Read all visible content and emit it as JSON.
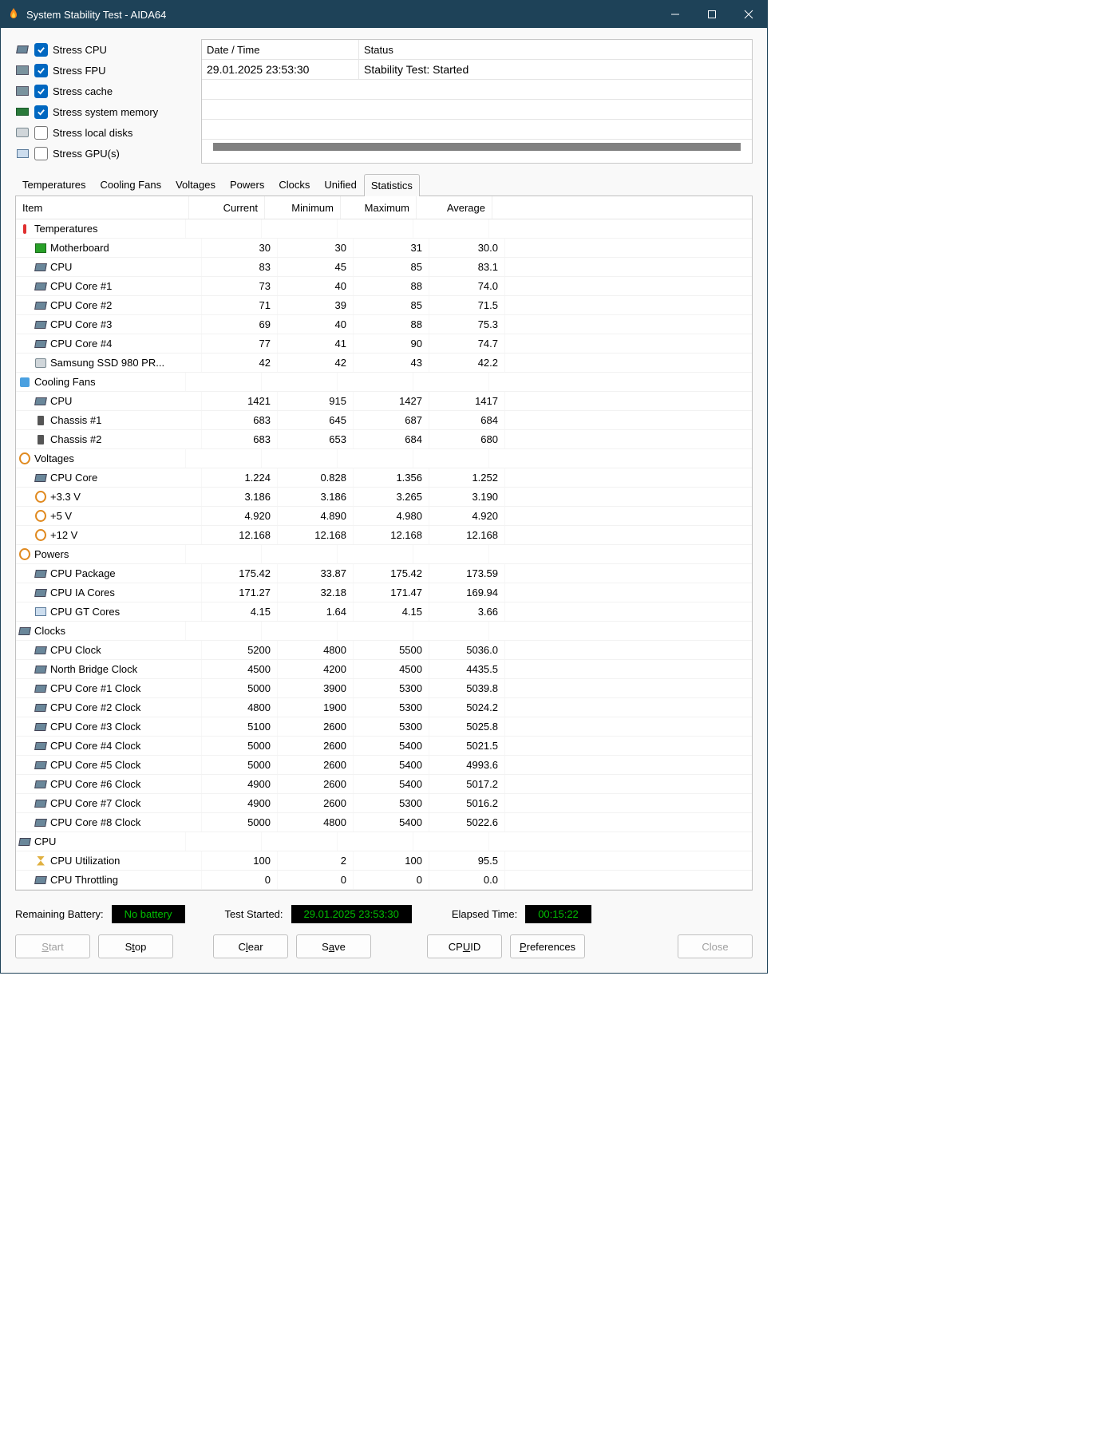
{
  "title": "System Stability Test - AIDA64",
  "stress": [
    {
      "label": "Stress CPU",
      "checked": true,
      "icon": "cpu"
    },
    {
      "label": "Stress FPU",
      "checked": true,
      "icon": "fpu"
    },
    {
      "label": "Stress cache",
      "checked": true,
      "icon": "cache"
    },
    {
      "label": "Stress system memory",
      "checked": true,
      "icon": "mem"
    },
    {
      "label": "Stress local disks",
      "checked": false,
      "icon": "disk"
    },
    {
      "label": "Stress GPU(s)",
      "checked": false,
      "icon": "gpu"
    }
  ],
  "log": {
    "headers": [
      "Date / Time",
      "Status"
    ],
    "rows": [
      [
        "29.01.2025 23:53:30",
        "Stability Test: Started"
      ]
    ]
  },
  "tabs": [
    "Temperatures",
    "Cooling Fans",
    "Voltages",
    "Powers",
    "Clocks",
    "Unified",
    "Statistics"
  ],
  "active_tab": "Statistics",
  "grid_headers": [
    "Item",
    "Current",
    "Minimum",
    "Maximum",
    "Average"
  ],
  "sections": [
    {
      "title": "Temperatures",
      "icon": "therm",
      "rows": [
        {
          "icon": "mb",
          "label": "Motherboard",
          "v": [
            "30",
            "30",
            "31",
            "30.0"
          ]
        },
        {
          "icon": "cpu",
          "label": "CPU",
          "v": [
            "83",
            "45",
            "85",
            "83.1"
          ]
        },
        {
          "icon": "cpu",
          "label": "CPU Core #1",
          "v": [
            "73",
            "40",
            "88",
            "74.0"
          ]
        },
        {
          "icon": "cpu",
          "label": "CPU Core #2",
          "v": [
            "71",
            "39",
            "85",
            "71.5"
          ]
        },
        {
          "icon": "cpu",
          "label": "CPU Core #3",
          "v": [
            "69",
            "40",
            "88",
            "75.3"
          ]
        },
        {
          "icon": "cpu",
          "label": "CPU Core #4",
          "v": [
            "77",
            "41",
            "90",
            "74.7"
          ]
        },
        {
          "icon": "disk",
          "label": "Samsung SSD 980 PR...",
          "v": [
            "42",
            "42",
            "43",
            "42.2"
          ]
        }
      ]
    },
    {
      "title": "Cooling Fans",
      "icon": "fan",
      "rows": [
        {
          "icon": "cpu",
          "label": "CPU",
          "v": [
            "1421",
            "915",
            "1427",
            "1417"
          ]
        },
        {
          "icon": "hd",
          "label": "Chassis #1",
          "v": [
            "683",
            "645",
            "687",
            "684"
          ]
        },
        {
          "icon": "hd",
          "label": "Chassis #2",
          "v": [
            "683",
            "653",
            "684",
            "680"
          ]
        }
      ]
    },
    {
      "title": "Voltages",
      "icon": "volt",
      "rows": [
        {
          "icon": "cpu",
          "label": "CPU Core",
          "v": [
            "1.224",
            "0.828",
            "1.356",
            "1.252"
          ]
        },
        {
          "icon": "volt",
          "label": "+3.3 V",
          "v": [
            "3.186",
            "3.186",
            "3.265",
            "3.190"
          ]
        },
        {
          "icon": "volt",
          "label": "+5 V",
          "v": [
            "4.920",
            "4.890",
            "4.980",
            "4.920"
          ]
        },
        {
          "icon": "volt",
          "label": "+12 V",
          "v": [
            "12.168",
            "12.168",
            "12.168",
            "12.168"
          ]
        }
      ]
    },
    {
      "title": "Powers",
      "icon": "volt",
      "rows": [
        {
          "icon": "cpu",
          "label": "CPU Package",
          "v": [
            "175.42",
            "33.87",
            "175.42",
            "173.59"
          ]
        },
        {
          "icon": "cpu",
          "label": "CPU IA Cores",
          "v": [
            "171.27",
            "32.18",
            "171.47",
            "169.94"
          ]
        },
        {
          "icon": "gpu",
          "label": "CPU GT Cores",
          "v": [
            "4.15",
            "1.64",
            "4.15",
            "3.66"
          ]
        }
      ]
    },
    {
      "title": "Clocks",
      "icon": "cpu",
      "rows": [
        {
          "icon": "cpu",
          "label": "CPU Clock",
          "v": [
            "5200",
            "4800",
            "5500",
            "5036.0"
          ]
        },
        {
          "icon": "cpu",
          "label": "North Bridge Clock",
          "v": [
            "4500",
            "4200",
            "4500",
            "4435.5"
          ]
        },
        {
          "icon": "cpu",
          "label": "CPU Core #1 Clock",
          "v": [
            "5000",
            "3900",
            "5300",
            "5039.8"
          ]
        },
        {
          "icon": "cpu",
          "label": "CPU Core #2 Clock",
          "v": [
            "4800",
            "1900",
            "5300",
            "5024.2"
          ]
        },
        {
          "icon": "cpu",
          "label": "CPU Core #3 Clock",
          "v": [
            "5100",
            "2600",
            "5300",
            "5025.8"
          ]
        },
        {
          "icon": "cpu",
          "label": "CPU Core #4 Clock",
          "v": [
            "5000",
            "2600",
            "5400",
            "5021.5"
          ]
        },
        {
          "icon": "cpu",
          "label": "CPU Core #5 Clock",
          "v": [
            "5000",
            "2600",
            "5400",
            "4993.6"
          ]
        },
        {
          "icon": "cpu",
          "label": "CPU Core #6 Clock",
          "v": [
            "4900",
            "2600",
            "5400",
            "5017.2"
          ]
        },
        {
          "icon": "cpu",
          "label": "CPU Core #7 Clock",
          "v": [
            "4900",
            "2600",
            "5300",
            "5016.2"
          ]
        },
        {
          "icon": "cpu",
          "label": "CPU Core #8 Clock",
          "v": [
            "5000",
            "4800",
            "5400",
            "5022.6"
          ]
        }
      ]
    },
    {
      "title": "CPU",
      "icon": "cpu",
      "rows": [
        {
          "icon": "hour",
          "label": "CPU Utilization",
          "v": [
            "100",
            "2",
            "100",
            "95.5"
          ]
        },
        {
          "icon": "cpu",
          "label": "CPU Throttling",
          "v": [
            "0",
            "0",
            "0",
            "0.0"
          ]
        }
      ]
    }
  ],
  "footer": {
    "battery_label": "Remaining Battery:",
    "battery_value": "No battery",
    "started_label": "Test Started:",
    "started_value": "29.01.2025 23:53:30",
    "elapsed_label": "Elapsed Time:",
    "elapsed_value": "00:15:22"
  },
  "buttons": {
    "start": "Start",
    "stop": "Stop",
    "clear": "Clear",
    "save": "Save",
    "cpuid": "CPUID",
    "prefs": "Preferences",
    "close": "Close"
  }
}
